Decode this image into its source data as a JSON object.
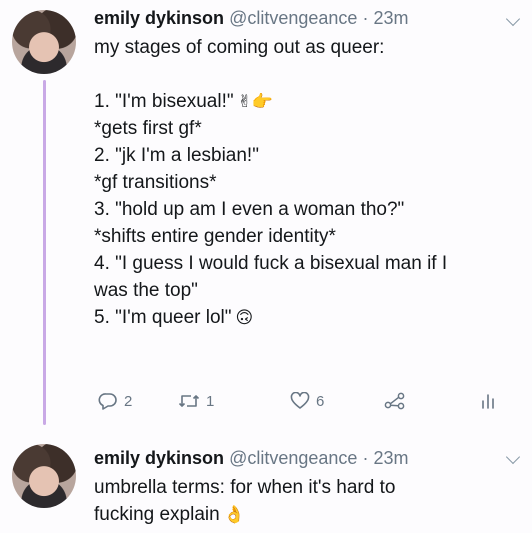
{
  "tweets": [
    {
      "name": "emily dykinson",
      "handle": "@clitvengeance",
      "separator": "·",
      "time": "23m",
      "lines": [
        "my stages of coming out as queer:",
        "",
        "1. \"I'm bisexual!\"",
        "*gets first gf*",
        "2. \"jk I'm a lesbian!\"",
        "*gf transitions*",
        "3. \"hold up am I even a woman tho?\"",
        "*shifts entire gender identity*",
        "4. \"I guess I would fuck a bisexual man if I",
        "was the top\"",
        "5. \"I'm queer lol\""
      ],
      "emojis": {
        "line2": "✌👉",
        "line10": "🙃"
      },
      "actions": {
        "reply_count": "2",
        "retweet_count": "1",
        "like_count": "6"
      },
      "icons": [
        "reply-icon",
        "retweet-icon",
        "like-icon",
        "share-icon",
        "analytics-icon",
        "chevron-down-icon"
      ]
    },
    {
      "name": "emily dykinson",
      "handle": "@clitvengeance",
      "separator": "·",
      "time": "23m",
      "lines": [
        "umbrella terms: for when it's hard to",
        "fucking explain"
      ],
      "emojis": {
        "line1": "👌"
      },
      "icons": [
        "chevron-down-icon"
      ]
    }
  ],
  "colors": {
    "thread_line": "#c9a9e6",
    "meta_text": "#687684",
    "body_text": "#14171a"
  }
}
